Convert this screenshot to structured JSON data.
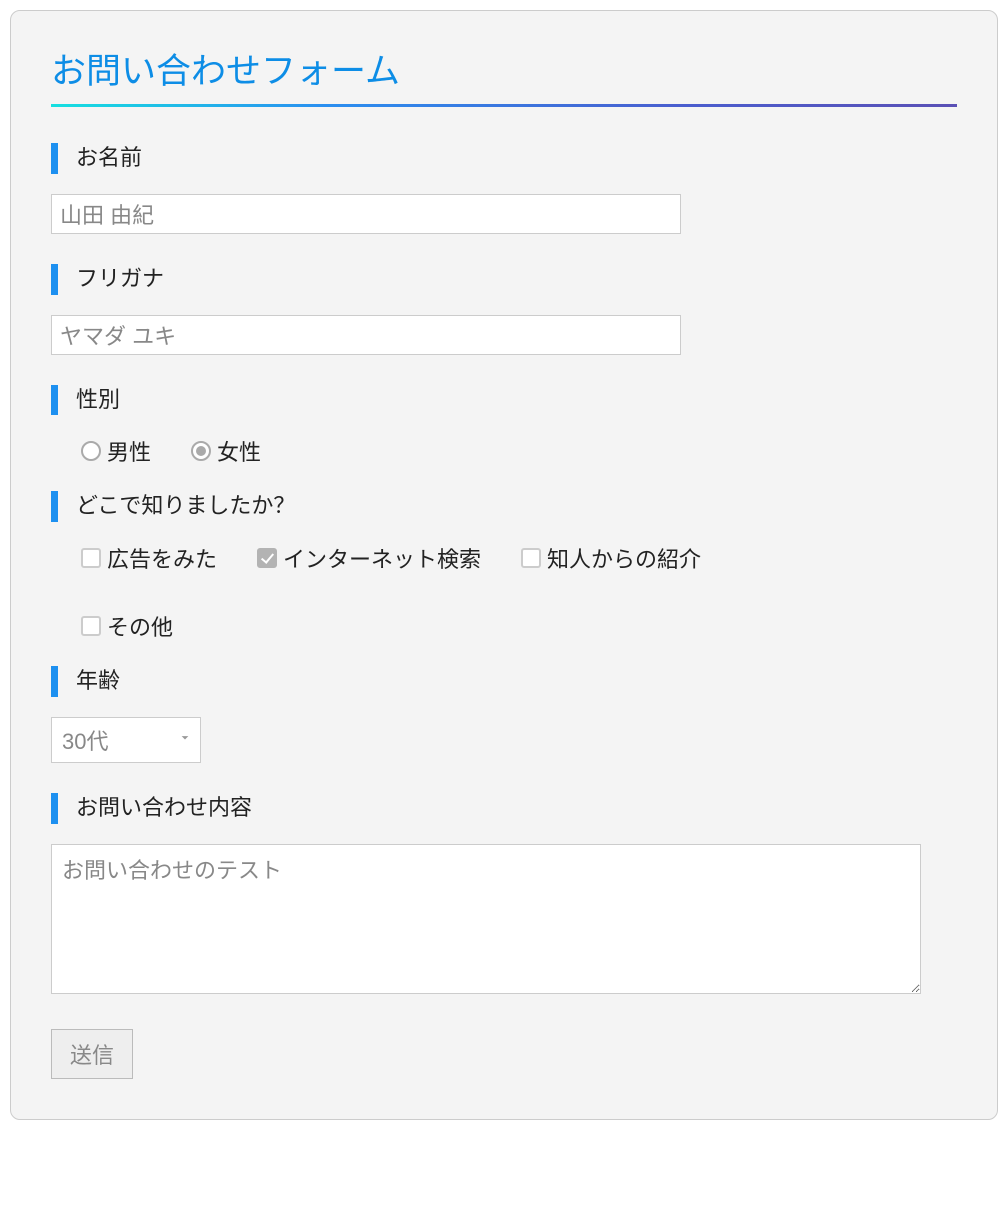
{
  "title": "お問い合わせフォーム",
  "name": {
    "label": "お名前",
    "value": "山田 由紀"
  },
  "kana": {
    "label": "フリガナ",
    "value": "ヤマダ ユキ"
  },
  "gender": {
    "label": "性別",
    "options": [
      {
        "label": "男性",
        "checked": false
      },
      {
        "label": "女性",
        "checked": true
      }
    ]
  },
  "source": {
    "label": "どこで知りましたか？",
    "options": [
      {
        "label": "広告をみた",
        "checked": false
      },
      {
        "label": "インターネット検索",
        "checked": true
      },
      {
        "label": "知人からの紹介",
        "checked": false
      },
      {
        "label": "その他",
        "checked": false
      }
    ]
  },
  "age": {
    "label": "年齢",
    "value": "30代"
  },
  "message": {
    "label": "お問い合わせ内容",
    "value": "お問い合わせのテスト"
  },
  "submit": {
    "label": "送信"
  }
}
